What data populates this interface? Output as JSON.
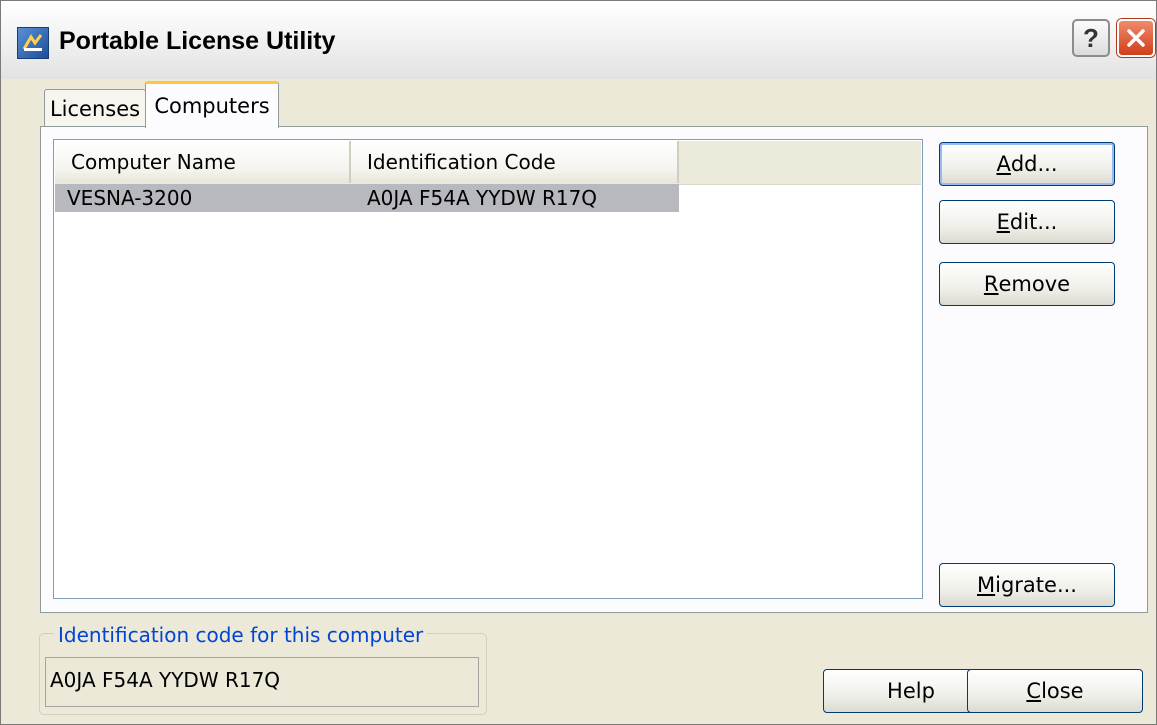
{
  "window": {
    "title": "Portable License Utility",
    "help_glyph": "?",
    "icon": "app-icon"
  },
  "tabs": [
    {
      "label": "Licenses",
      "active": false
    },
    {
      "label": "Computers",
      "active": true
    }
  ],
  "table": {
    "columns": [
      "Computer Name",
      "Identification Code"
    ],
    "rows": [
      {
        "computer_name": "VESNA-3200",
        "identification_code": "A0JA F54A YYDW R17Q",
        "selected": true
      }
    ]
  },
  "buttons": {
    "add": {
      "before": "",
      "mnemonic": "A",
      "after": "dd..."
    },
    "edit": {
      "before": "",
      "mnemonic": "E",
      "after": "dit..."
    },
    "remove": {
      "before": "",
      "mnemonic": "R",
      "after": "emove"
    },
    "migrate": {
      "before": "",
      "mnemonic": "M",
      "after": "igrate..."
    },
    "help": "Help",
    "close": {
      "before": "",
      "mnemonic": "C",
      "after": "lose"
    }
  },
  "id_group": {
    "legend": "Identification code for this computer",
    "value": "A0JA F54A YYDW R17Q"
  },
  "colors": {
    "legend": "#0046d5",
    "selection": "#b8b8bf",
    "tab_highlight": "#ffc83c",
    "close_button": "#d23d1a"
  }
}
